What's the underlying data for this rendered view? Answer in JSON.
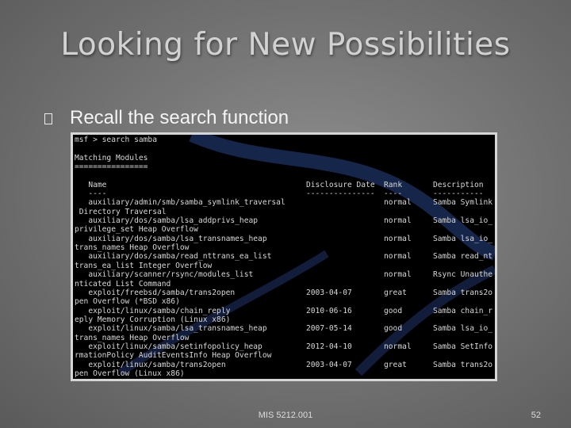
{
  "slide": {
    "title": "Looking for New Possibilities",
    "bullet": "Recall the search function",
    "footer": "MIS 5212.001",
    "page_number": "52"
  },
  "terminal": {
    "lines": [
      {
        "name": "msf > search samba"
      },
      {
        "name": ""
      },
      {
        "name": "Matching Modules"
      },
      {
        "name": "================"
      },
      {
        "name": ""
      },
      {
        "name": "   Name",
        "date": "Disclosure Date",
        "rank": "Rank",
        "desc": "Description"
      },
      {
        "name": "   ----",
        "date": "---------------",
        "rank": "----",
        "desc": "-----------"
      },
      {
        "name": "   auxiliary/admin/smb/samba_symlink_traversal",
        "rank": "normal",
        "desc": "Samba Symlink"
      },
      {
        "name": " Directory Traversal"
      },
      {
        "name": "   auxiliary/dos/samba/lsa_addprivs_heap",
        "rank": "normal",
        "desc": "Samba lsa_io_"
      },
      {
        "name": "privilege_set Heap Overflow"
      },
      {
        "name": "   auxiliary/dos/samba/lsa_transnames_heap",
        "rank": "normal",
        "desc": "Samba lsa_io_"
      },
      {
        "name": "trans_names Heap Overflow"
      },
      {
        "name": "   auxiliary/dos/samba/read_nttrans_ea_list",
        "rank": "normal",
        "desc": "Samba read_nt"
      },
      {
        "name": "trans_ea_list Integer Overflow"
      },
      {
        "name": "   auxiliary/scanner/rsync/modules_list",
        "rank": "normal",
        "desc": "Rsync Unauthe"
      },
      {
        "name": "nticated List Command"
      },
      {
        "name": "   exploit/freebsd/samba/trans2open",
        "date": "2003-04-07",
        "rank": "great",
        "desc": "Samba trans2o"
      },
      {
        "name": "pen Overflow (*BSD x86)"
      },
      {
        "name": "   exploit/linux/samba/chain_reply",
        "date": "2010-06-16",
        "rank": "good",
        "desc": "Samba chain_r"
      },
      {
        "name": "eply Memory Corruption (Linux x86)"
      },
      {
        "name": "   exploit/linux/samba/lsa_transnames_heap",
        "date": "2007-05-14",
        "rank": "good",
        "desc": "Samba lsa_io_"
      },
      {
        "name": "trans_names Heap Overflow"
      },
      {
        "name": "   exploit/linux/samba/setinfopolicy_heap",
        "date": "2012-04-10",
        "rank": "normal",
        "desc": "Samba SetInfo"
      },
      {
        "name": "rmationPolicy AuditEventsInfo Heap Overflow"
      },
      {
        "name": "   exploit/linux/samba/trans2open",
        "date": "2003-04-07",
        "rank": "great",
        "desc": "Samba trans2o"
      },
      {
        "name": "pen Overflow (Linux x86)"
      }
    ]
  },
  "colors": {
    "terminal_background": "#000000",
    "terminal_text": "#d8d8d8",
    "terminal_watermark": "#16264a",
    "title_text": "#d2d2d2"
  }
}
